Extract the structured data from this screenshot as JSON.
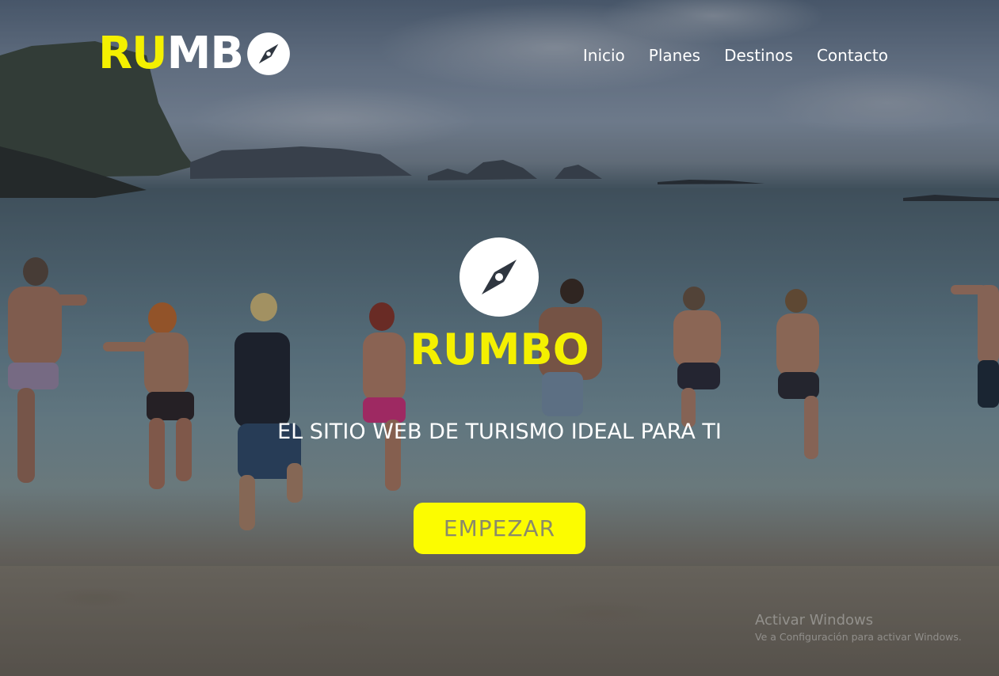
{
  "header": {
    "logo_part_yellow": "RU",
    "logo_part_white": "MB",
    "nav": [
      {
        "label": "Inicio"
      },
      {
        "label": "Planes"
      },
      {
        "label": "Destinos"
      },
      {
        "label": "Contacto"
      }
    ]
  },
  "hero": {
    "brand_title": "RUMBO",
    "tagline": "EL SITIO WEB DE TURISMO IDEAL PARA TI",
    "cta_label": "EMPEZAR"
  },
  "watermark": {
    "title": "Activar Windows",
    "subtitle": "Ve a Configuración para activar Windows."
  },
  "colors": {
    "accent_yellow": "#f4f000",
    "button_yellow": "#fcfc00",
    "text_white": "#ffffff"
  },
  "icons": {
    "logo_icon": "compass-icon",
    "hero_icon": "compass-icon"
  }
}
